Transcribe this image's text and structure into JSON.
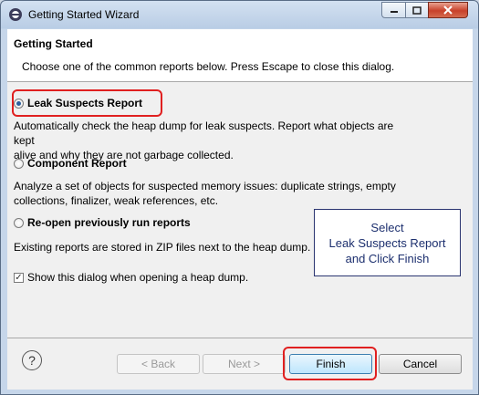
{
  "window": {
    "title": "Getting Started Wizard"
  },
  "header": {
    "title": "Getting Started",
    "description": "Choose one of the common reports below. Press Escape to close this dialog."
  },
  "options": [
    {
      "label": "Leak Suspects Report",
      "checked": true,
      "description_lines": [
        "Automatically check the heap dump for leak suspects. Report what objects are kept",
        "alive and why they are not garbage collected."
      ]
    },
    {
      "label": "Component Report",
      "checked": false,
      "description_lines": [
        "Analyze a set of objects for suspected memory issues: duplicate strings, empty",
        "collections, finalizer, weak references, etc."
      ]
    },
    {
      "label": "Re-open previously run reports",
      "checked": false,
      "description_lines": [
        "Existing reports are stored in ZIP files next to the heap dump."
      ]
    }
  ],
  "callout": {
    "lines": [
      "Select",
      "Leak Suspects Report",
      "and Click Finish"
    ]
  },
  "show_dialog_checkbox": {
    "label": "Show this dialog when opening a heap dump.",
    "checked": true
  },
  "buttons": {
    "back": "< Back",
    "next": "Next >",
    "finish": "Finish",
    "cancel": "Cancel"
  },
  "colors": {
    "highlight": "#e02020",
    "callout_text": "#1c2f6e",
    "radio_dot": "#2b5f9e"
  }
}
